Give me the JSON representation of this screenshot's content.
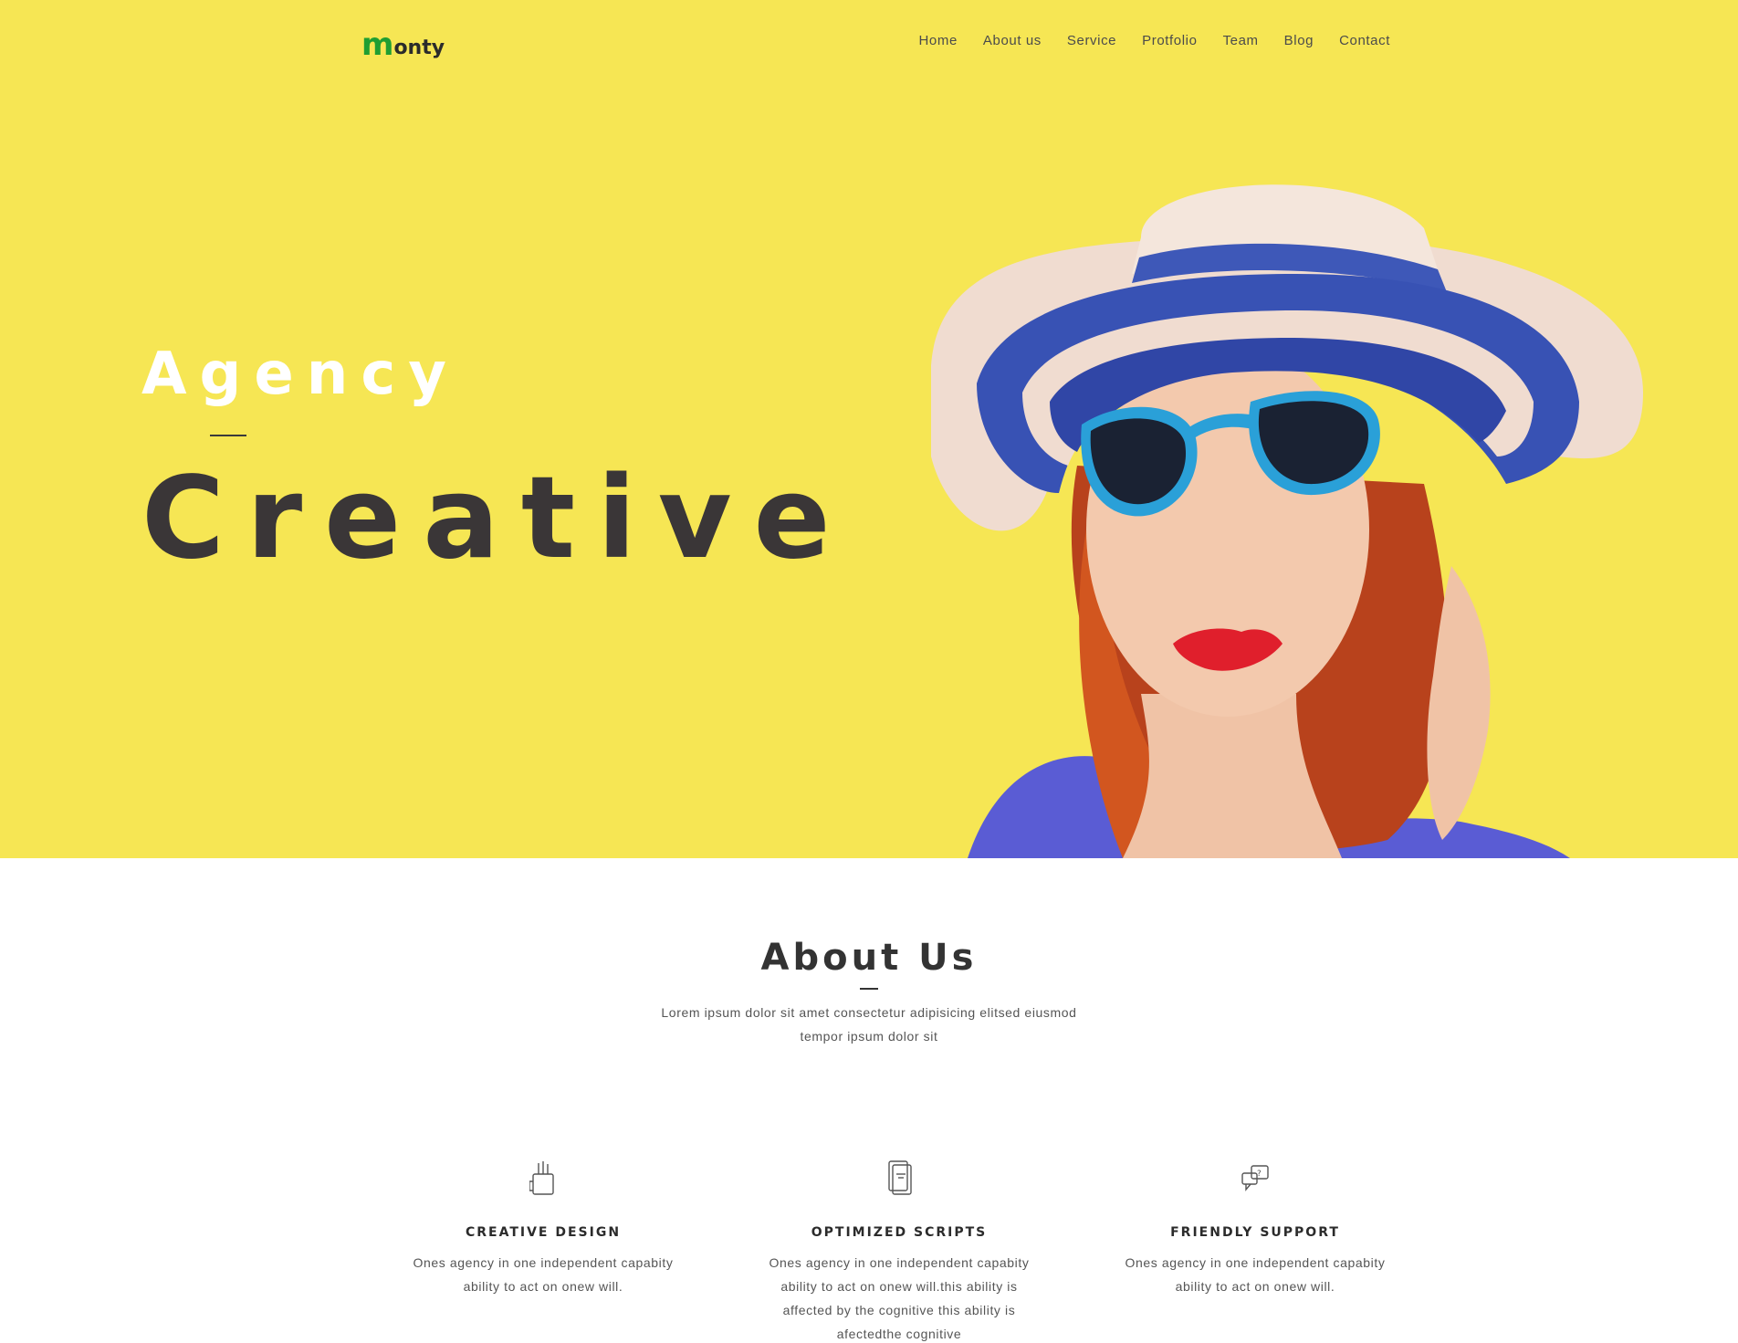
{
  "header": {
    "logo": {
      "first_letter": "m",
      "rest": "onty",
      "colors": [
        "#1f9e32",
        "#d3257d",
        "#2b2b2b"
      ]
    },
    "nav": [
      "Home",
      "About us",
      "Service",
      "Protfolio",
      "Team",
      "Blog",
      "Contact"
    ]
  },
  "hero": {
    "subtitle": "Agency",
    "title": "Creative",
    "background_color": "#f6e654"
  },
  "about": {
    "title": "About Us",
    "description": "Lorem ipsum dolor sit amet consectetur adipisicing elitsed eiusmod tempor ipsum dolor sit",
    "features": [
      {
        "icon": "pencil-cup-icon",
        "title": "CREATIVE DESIGN",
        "text": "Ones agency in one independent capabity ability to act on onew will."
      },
      {
        "icon": "document-icon",
        "title": "OPTIMIZED SCRIPTS",
        "text": "Ones agency in one independent capabity ability to act on onew will.this ability is affected by the cognitive this ability is afectedthe cognitive"
      },
      {
        "icon": "chat-bubbles-icon",
        "title": "FRIENDLY SUPPORT",
        "text": "Ones agency in one independent capabity ability to act on onew will."
      }
    ]
  }
}
